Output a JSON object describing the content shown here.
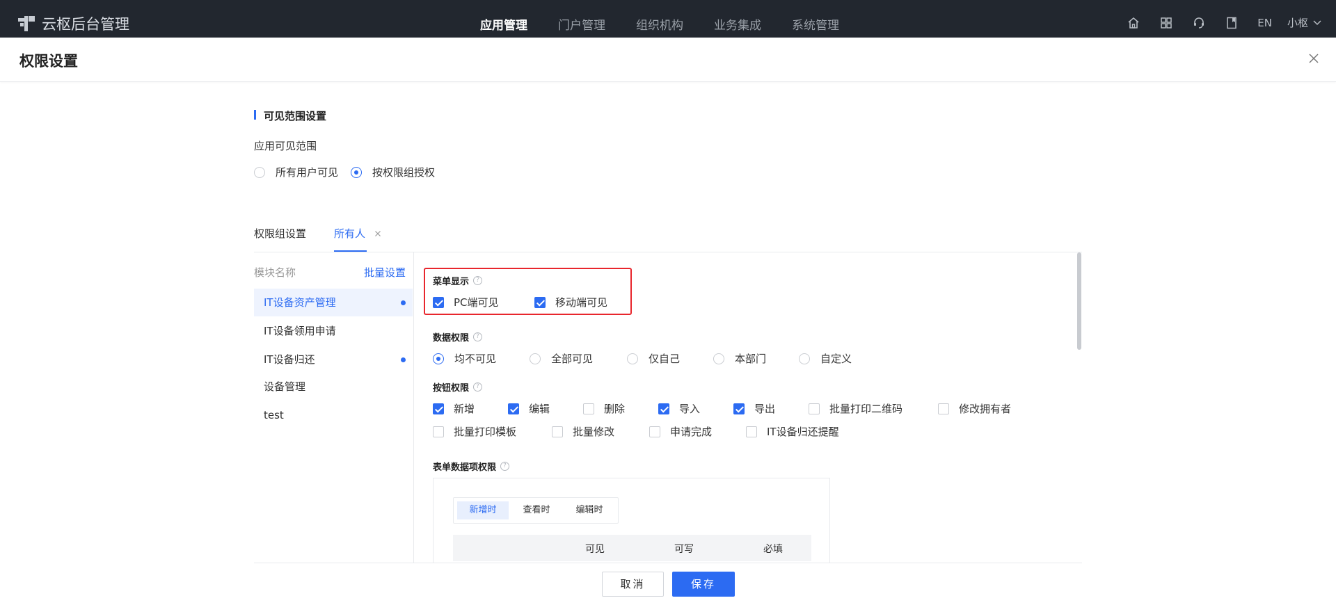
{
  "topbar": {
    "app_title": "云枢后台管理",
    "nav": [
      "应用管理",
      "门户管理",
      "组织机构",
      "业务集成",
      "系统管理"
    ],
    "active_nav": 0,
    "lang": "EN",
    "user": "小枢",
    "icons": [
      "home-icon",
      "apps-grid-icon",
      "support-icon",
      "book-icon"
    ]
  },
  "page": {
    "title": "权限设置"
  },
  "visibility": {
    "section_title": "可见范围设置",
    "label": "应用可见范围",
    "options": [
      "所有用户可见",
      "按权限组授权"
    ],
    "selected": 1
  },
  "tabs": {
    "items": [
      "权限组设置",
      "所有人"
    ],
    "active": 1
  },
  "modules": {
    "header": "模块名称",
    "batch": "批量设置",
    "items": [
      {
        "label": "IT设备资产管理",
        "dot": true
      },
      {
        "label": "IT设备领用申请",
        "dot": false
      },
      {
        "label": "IT设备归还",
        "dot": true
      },
      {
        "label": "设备管理",
        "dot": false
      },
      {
        "label": "test",
        "dot": false
      }
    ],
    "active": 0
  },
  "menu_display": {
    "title": "菜单显示",
    "options": [
      {
        "label": "PC端可见",
        "checked": true
      },
      {
        "label": "移动端可见",
        "checked": true
      }
    ]
  },
  "data_permission": {
    "title": "数据权限",
    "options": [
      "均不可见",
      "全部可见",
      "仅自己",
      "本部门",
      "自定义"
    ],
    "selected": 0
  },
  "button_permission": {
    "title": "按钮权限",
    "row1": [
      {
        "label": "新增",
        "checked": true
      },
      {
        "label": "编辑",
        "checked": true
      },
      {
        "label": "删除",
        "checked": false
      },
      {
        "label": "导入",
        "checked": true
      },
      {
        "label": "导出",
        "checked": true
      },
      {
        "label": "批量打印二维码",
        "checked": false
      },
      {
        "label": "修改拥有者",
        "checked": false
      }
    ],
    "row2": [
      {
        "label": "批量打印模板",
        "checked": false
      },
      {
        "label": "批量修改",
        "checked": false
      },
      {
        "label": "申请完成",
        "checked": false
      },
      {
        "label": "IT设备归还提醒",
        "checked": false
      }
    ]
  },
  "form_permission": {
    "title": "表单数据项权限",
    "modes": [
      "新增时",
      "查看时",
      "编辑时"
    ],
    "active_mode": 0,
    "columns": [
      "可见",
      "可写",
      "必填"
    ]
  },
  "footer": {
    "cancel": "取消",
    "save": "保存"
  },
  "colors": {
    "accent": "#2c6bf2",
    "topbar": "#22272f",
    "highlight_box": "#e8262d"
  }
}
